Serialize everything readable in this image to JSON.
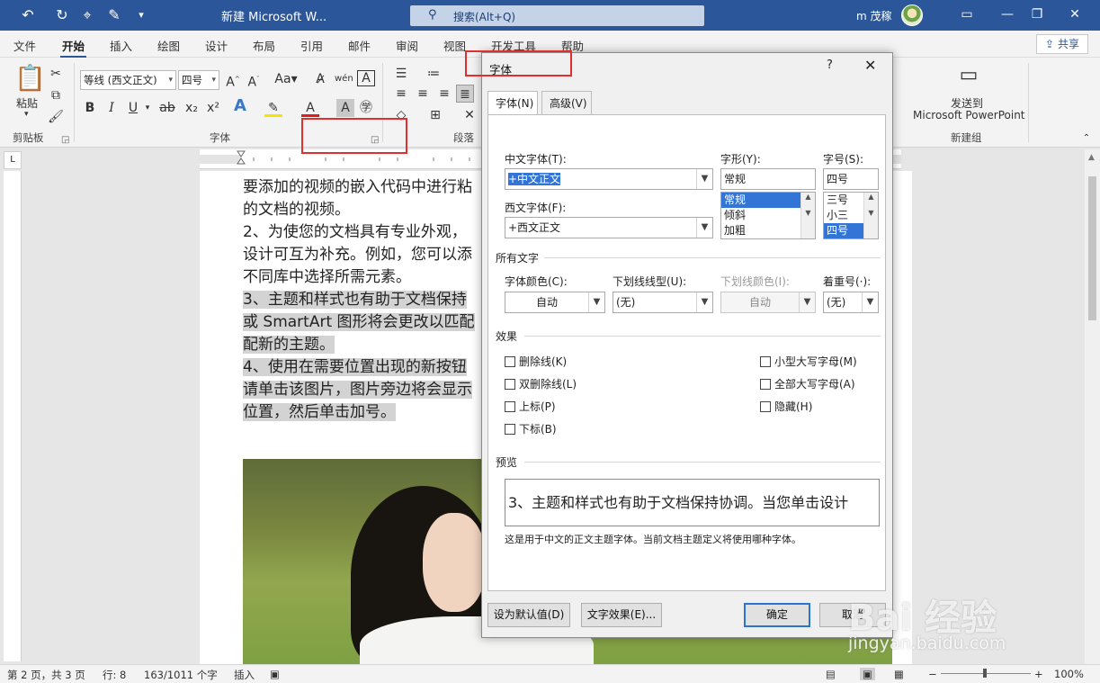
{
  "titlebar": {
    "doc_title": "新建 Microsoft W...",
    "search_placeholder": "搜索(Alt+Q)",
    "user_name": "m 茂稼",
    "minimize": "—",
    "restore": "❐",
    "close": "✕"
  },
  "tabs": [
    "文件",
    "开始",
    "插入",
    "绘图",
    "设计",
    "布局",
    "引用",
    "邮件",
    "审阅",
    "视图",
    "开发工具",
    "帮助"
  ],
  "share_label": "共享",
  "ribbon": {
    "paste_label": "粘贴",
    "clipboard_label": "剪贴板",
    "font_name": "等线 (西文正文)",
    "font_size": "四号",
    "font_group_label": "字体",
    "paragraph_group_label": "段落",
    "send_to_label": "发送到",
    "send_to_app": "Microsoft PowerPoint",
    "new_group_label": "新建组"
  },
  "document": {
    "lines": [
      "要添加的视频的嵌入代码中进行粘",
      "的文档的视频。",
      "2、为使您的文档具有专业外观，",
      "设计可互为补充。例如，您可以添",
      "不同库中选择所需元素。",
      "3、主题和样式也有助于文档保持",
      "或 SmartArt 图形将会更改以匹配",
      "配新的主题。",
      "4、使用在需要位置出现的新按钮",
      "请单击该图片，图片旁边将会显示",
      "位置，然后单击加号。"
    ]
  },
  "dialog": {
    "title": "字体",
    "help": "?",
    "close": "✕",
    "tabs": [
      "字体(N)",
      "高级(V)"
    ],
    "cn_font_label": "中文字体(T):",
    "cn_font_value": "+中文正文",
    "west_font_label": "西文字体(F):",
    "west_font_value": "+西文正文",
    "style_label": "字形(Y):",
    "style_value": "常规",
    "style_options": [
      "常规",
      "倾斜",
      "加粗"
    ],
    "size_label": "字号(S):",
    "size_value": "四号",
    "size_options": [
      "三号",
      "小三",
      "四号"
    ],
    "all_text_label": "所有文字",
    "font_color_label": "字体颜色(C):",
    "font_color_value": "自动",
    "underline_label": "下划线线型(U):",
    "underline_value": "(无)",
    "underline_color_label": "下划线颜色(I):",
    "underline_color_value": "自动",
    "emphasis_label": "着重号(·):",
    "emphasis_value": "(无)",
    "effects_label": "效果",
    "effects_left": [
      "删除线(K)",
      "双删除线(L)",
      "上标(P)",
      "下标(B)"
    ],
    "effects_right": [
      "小型大写字母(M)",
      "全部大写字母(A)",
      "隐藏(H)"
    ],
    "preview_label": "预览",
    "preview_text": "3、主题和样式也有助于文档保持协调。当您单击设计",
    "note": "这是用于中文的正文主题字体。当前文档主题定义将使用哪种字体。",
    "default_btn": "设为默认值(D)",
    "effects_btn": "文字效果(E)...",
    "ok_btn": "确定",
    "cancel_btn": "取消"
  },
  "status": {
    "page": "第 2 页，共 3 页",
    "line": "行: 8",
    "words": "163/1011 个字",
    "mode": "插入",
    "zoom": "100%"
  },
  "watermark": {
    "main": "Bai 经验",
    "sub": "jingyan.baidu.com"
  }
}
